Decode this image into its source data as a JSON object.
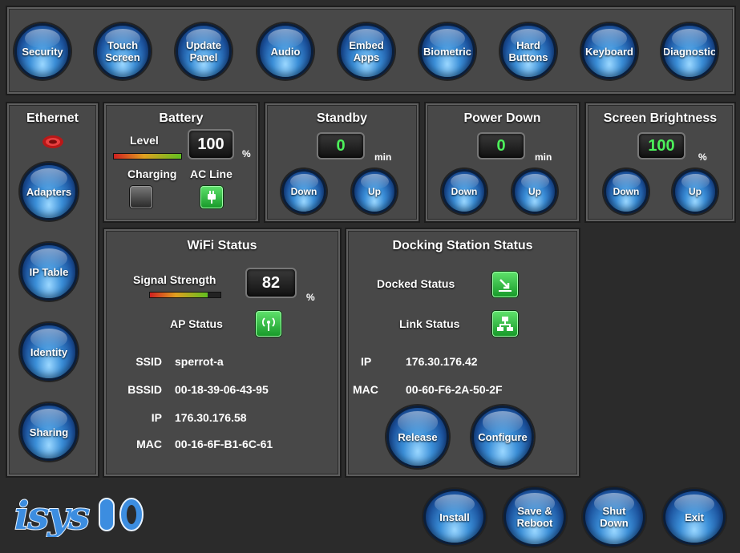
{
  "top_nav": [
    {
      "label": "Security"
    },
    {
      "label": "Touch\nScreen"
    },
    {
      "label": "Update\nPanel"
    },
    {
      "label": "Audio"
    },
    {
      "label": "Embed\nApps"
    },
    {
      "label": "Biometric"
    },
    {
      "label": "Hard\nButtons"
    },
    {
      "label": "Keyboard"
    },
    {
      "label": "Diagnostic"
    }
  ],
  "sidebar": {
    "title": "Ethernet",
    "items": [
      {
        "label": "Adapters"
      },
      {
        "label": "IP Table"
      },
      {
        "label": "Identity"
      },
      {
        "label": "Sharing"
      }
    ]
  },
  "battery": {
    "title": "Battery",
    "level_label": "Level",
    "level_value": "100",
    "unit": "%",
    "charging_label": "Charging",
    "ac_line_label": "AC Line"
  },
  "standby": {
    "title": "Standby",
    "value": "0",
    "unit": "min",
    "down": "Down",
    "up": "Up"
  },
  "power_down": {
    "title": "Power Down",
    "value": "0",
    "unit": "min",
    "down": "Down",
    "up": "Up"
  },
  "brightness": {
    "title": "Screen Brightness",
    "value": "100",
    "unit": "%",
    "down": "Down",
    "up": "Up"
  },
  "wifi": {
    "title": "WiFi Status",
    "signal_label": "Signal Strength",
    "signal_value": "82",
    "signal_fraction": 0.82,
    "unit": "%",
    "ap_label": "AP Status",
    "ssid_k": "SSID",
    "ssid_v": "sperrot-a",
    "bssid_k": "BSSID",
    "bssid_v": "00-18-39-06-43-95",
    "ip_k": "IP",
    "ip_v": "176.30.176.58",
    "mac_k": "MAC",
    "mac_v": "00-16-6F-B1-6C-61"
  },
  "dock": {
    "title": "Docking Station Status",
    "docked_label": "Docked Status",
    "link_label": "Link Status",
    "ip_k": "IP",
    "ip_v": "176.30.176.42",
    "mac_k": "MAC",
    "mac_v": "00-60-F6-2A-50-2F",
    "release": "Release",
    "configure": "Configure"
  },
  "footer": {
    "logo_text": "isysio",
    "install": "Install",
    "save_reboot": "Save &\nReboot",
    "shut_down": "Shut\nDown",
    "exit": "Exit"
  }
}
